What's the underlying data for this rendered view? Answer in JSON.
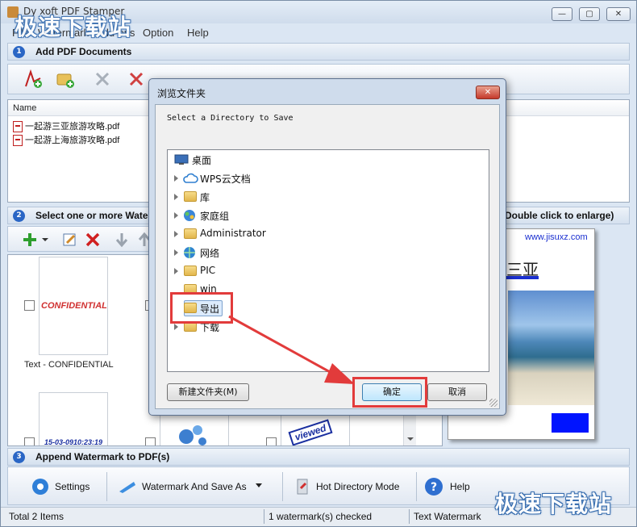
{
  "window": {
    "title": "Dy xoft PDF Stamper",
    "buttons": {
      "minimize": "—",
      "maximize": "▢",
      "close": "✕"
    }
  },
  "menu": [
    "File",
    "Watermark",
    "Add-ons",
    "Option",
    "Help"
  ],
  "section1": {
    "number": "1",
    "title": "Add PDF Documents"
  },
  "file_list": {
    "column": "Name",
    "files": [
      "一起游三亚旅游攻略.pdf",
      "一起游上海旅游攻略.pdf"
    ]
  },
  "section2": {
    "number": "2",
    "title": "Select one or more Watermark(s)",
    "preview_hint": "Double click to enlarge)"
  },
  "watermarks": [
    {
      "text": "CONFIDENTIAL",
      "label": "Text - CONFIDENTIAL"
    },
    {
      "text": "15-03-0910:23:19",
      "label": ""
    },
    {
      "text": "viewed",
      "label": ""
    }
  ],
  "preview": {
    "url": "www.jisuxz.com",
    "title": "三亚"
  },
  "section3": {
    "number": "3",
    "title": "Append Watermark to PDF(s)"
  },
  "actions": {
    "settings": "Settings",
    "save_as": "Watermark And Save As",
    "hot_dir": "Hot Directory Mode",
    "help": "Help"
  },
  "status": {
    "items": "Total 2 Items",
    "checked": "1 watermark(s) checked",
    "type": "Text Watermark"
  },
  "overlay_logo": "极速下载站",
  "dialog": {
    "title": "浏览文件夹",
    "prompt": "Select a Directory to Save",
    "tree": [
      {
        "label": "桌面",
        "icon": "desktop-icon"
      },
      {
        "label": "WPS云文档",
        "icon": "cloud-icon"
      },
      {
        "label": "库",
        "icon": "folder-icon"
      },
      {
        "label": "家庭组",
        "icon": "homegroup-icon"
      },
      {
        "label": "Administrator",
        "icon": "user-folder-icon"
      },
      {
        "label": "网络",
        "icon": "network-icon"
      },
      {
        "label": "PIC",
        "icon": "folder-icon"
      },
      {
        "label": "win",
        "icon": "folder-icon"
      },
      {
        "label": "导出",
        "icon": "folder-icon"
      },
      {
        "label": "下载",
        "icon": "folder-icon"
      }
    ],
    "new_folder": "新建文件夹(M)",
    "ok": "确定",
    "cancel": "取消"
  },
  "colors": {
    "annotation": "#e23b3b",
    "accent": "#2a66c5"
  }
}
